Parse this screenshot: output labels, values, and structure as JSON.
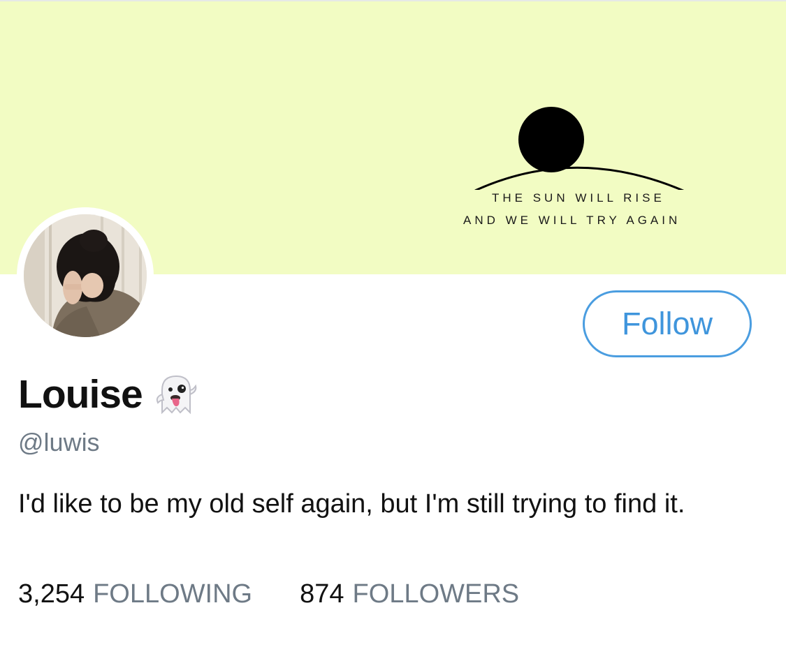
{
  "colors": {
    "banner_bg": "#f2fcc3",
    "accent_blue": "#4a9de0",
    "text_primary": "#111111",
    "text_secondary": "#6e7a86"
  },
  "banner": {
    "line1": "THE SUN WILL RISE",
    "line2": "AND WE WILL TRY AGAIN",
    "graphic": "sun-rising-over-horizon"
  },
  "profile": {
    "avatar_icon": "avatar",
    "follow_label": "Follow",
    "display_name": "Louise",
    "name_emoji_icon": "ghost-icon",
    "handle": "@luwis",
    "bio": "I'd like to be my old self again, but I'm still trying to find it."
  },
  "stats": {
    "following_count": "3,254",
    "following_label": "FOLLOWING",
    "followers_count": "874",
    "followers_label": "FOLLOWERS"
  }
}
